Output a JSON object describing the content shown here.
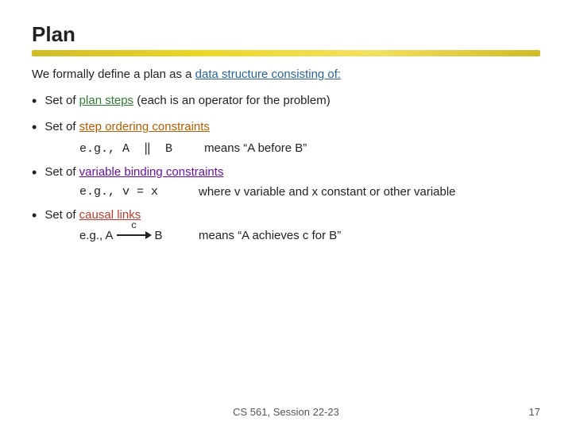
{
  "slide": {
    "title": "Plan",
    "intro": {
      "text_before": "We formally define a plan as a ",
      "highlight": "data structure consisting of:",
      "text_after": ""
    },
    "bullets": [
      {
        "id": "bullet1",
        "prefix": "Set of ",
        "highlight": "plan steps",
        "suffix": " (each is an operator for the problem)",
        "highlight_class": "highlight-green",
        "example": null
      },
      {
        "id": "bullet2",
        "prefix": "Set of ",
        "highlight": "step ordering constraints",
        "suffix": "",
        "highlight_class": "highlight-orange",
        "example": {
          "expr": "e.g., A  ΙΙ  B",
          "meaning": "means “A before B”"
        }
      },
      {
        "id": "bullet3",
        "prefix": "Set of ",
        "highlight": "variable binding constraints",
        "suffix": "",
        "highlight_class": "highlight-purple",
        "example": {
          "expr": "e.g., v = x",
          "meaning": "where v variable and x constant or other variable"
        }
      },
      {
        "id": "bullet4",
        "prefix": "Set of ",
        "highlight": "causal links",
        "suffix": "",
        "highlight_class": "highlight-red",
        "example": {
          "expr_left": "e.g., A",
          "causal_label": "c",
          "expr_right": "B",
          "meaning": "means “A achieves c for B”"
        }
      }
    ],
    "footer": {
      "center": "CS 561,  Session 22-23",
      "page": "17"
    }
  }
}
